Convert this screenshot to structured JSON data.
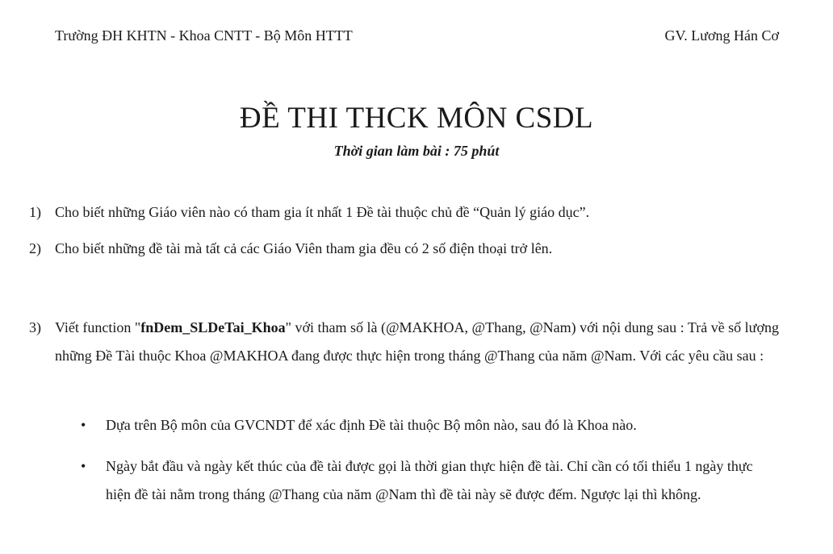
{
  "header": {
    "left": "Trường ĐH KHTN - Khoa CNTT - Bộ Môn HTTT",
    "right": "GV. Lương Hán Cơ"
  },
  "title": "ĐỀ THI THCK MÔN CSDL",
  "subtitle": "Thời gian làm bài : 75 phút",
  "questions": [
    {
      "num": "1)",
      "text": "Cho biết những Giáo viên nào có tham gia ít nhất 1 Đề tài thuộc chủ đề “Quản lý giáo dục”."
    },
    {
      "num": "2)",
      "text": "Cho biết những đề tài mà tất cả các Giáo Viên tham gia đều có 2 số điện thoại trở lên."
    },
    {
      "num": "3)",
      "text_before": "Viết function \"",
      "fn_name": "fnDem_SLDeTai_Khoa",
      "text_after": "\" với tham số là (@MAKHOA, @Thang, @Nam) với nội dung sau : Trả về số lượng những Đề Tài thuộc Khoa @MAKHOA đang được thực hiện trong tháng @Thang của năm @Nam. Với các yêu cầu sau :"
    }
  ],
  "bullets": [
    {
      "dot": "•",
      "text": "Dựa trên Bộ môn của GVCNDT để xác định Đề tài thuộc Bộ môn nào, sau đó là Khoa nào."
    },
    {
      "dot": "•",
      "text": "Ngày bắt đầu và ngày kết thúc của đề tài được gọi là thời gian thực hiện đề tài. Chỉ cần có tối thiểu 1 ngày thực hiện đề tài nằm trong tháng @Thang của năm @Nam thì đề tài này sẽ được đếm. Ngược lại thì không."
    }
  ]
}
